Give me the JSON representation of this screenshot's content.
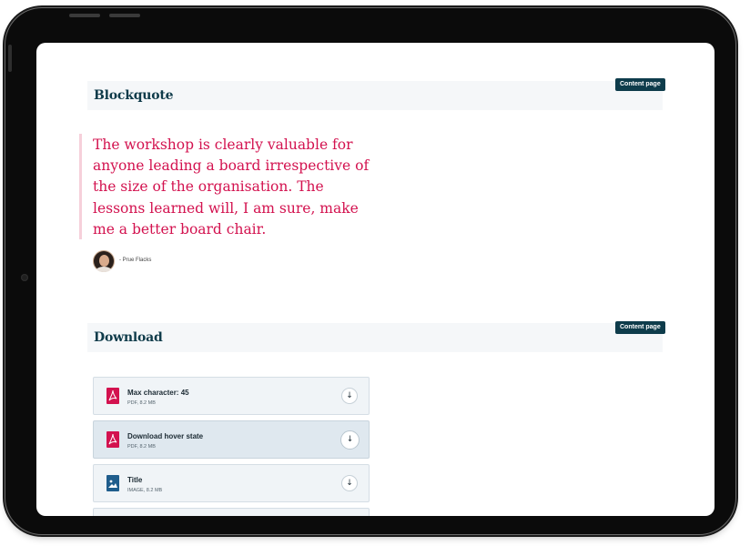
{
  "blockquote_section": {
    "title": "Blockquote",
    "badge": "Content page",
    "quote": "The workshop is clearly valuable for anyone leading a board irrespective of the size of the organisation. The lessons learned will, I am sure, make me a better board chair.",
    "author": "- Prue Flacks"
  },
  "download_section": {
    "title": "Download",
    "badge": "Content page",
    "items": [
      {
        "title": "Max character: 45",
        "meta": "PDF, 8.2 MB",
        "icon": "pdf-file-icon",
        "state": "default"
      },
      {
        "title": "Download hover state",
        "meta": "PDF, 8.2 MB",
        "icon": "pdf-file-icon",
        "state": "hover"
      },
      {
        "title": "Title",
        "meta": "IMAGE, 8.2 MB",
        "icon": "image-file-icon",
        "state": "default"
      }
    ],
    "download_glyph": "↓"
  },
  "colors": {
    "heading": "#0f3b4a",
    "badge_bg": "#0e3c4b",
    "quote_text": "#d3124f",
    "quote_bar": "#f6d0da",
    "pdf_icon": "#d3124f",
    "image_icon": "#1f5d8c"
  }
}
